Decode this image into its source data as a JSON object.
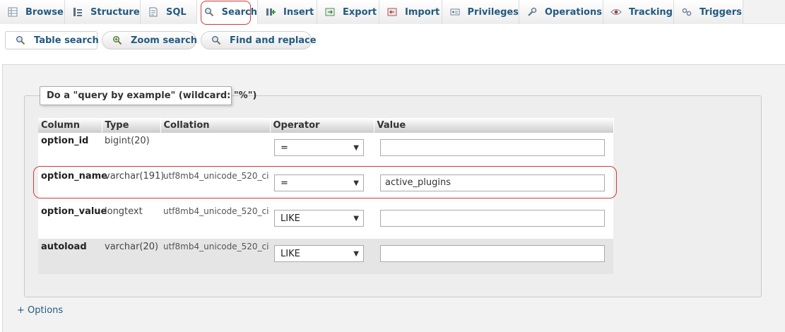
{
  "tabs": [
    {
      "label": "Browse",
      "icon": "browse-icon"
    },
    {
      "label": "Structure",
      "icon": "structure-icon"
    },
    {
      "label": "SQL",
      "icon": "sql-icon"
    },
    {
      "label": "Search",
      "icon": "search-icon",
      "active": true
    },
    {
      "label": "Insert",
      "icon": "insert-icon"
    },
    {
      "label": "Export",
      "icon": "export-icon"
    },
    {
      "label": "Import",
      "icon": "import-icon"
    },
    {
      "label": "Privileges",
      "icon": "privileges-icon"
    },
    {
      "label": "Operations",
      "icon": "wrench-icon"
    },
    {
      "label": "Tracking",
      "icon": "eye-icon"
    },
    {
      "label": "Triggers",
      "icon": "triggers-icon"
    }
  ],
  "subtabs": [
    {
      "label": "Table search",
      "icon": "magnifier-icon",
      "active": true
    },
    {
      "label": "Zoom search",
      "icon": "zoom-icon"
    },
    {
      "label": "Find and replace",
      "icon": "magnifier-icon"
    }
  ],
  "legend": "Do a \"query by example\" (wildcard: \"%\")",
  "table": {
    "headers": [
      "Column",
      "Type",
      "Collation",
      "Operator",
      "Value"
    ],
    "rows": [
      {
        "column": "option_id",
        "type": "bigint(20)",
        "collation": "",
        "operator": "=",
        "value": ""
      },
      {
        "column": "option_name",
        "type": "varchar(191)",
        "collation": "utf8mb4_unicode_520_ci",
        "operator": "=",
        "value": "active_plugins"
      },
      {
        "column": "option_value",
        "type": "longtext",
        "collation": "utf8mb4_unicode_520_ci",
        "operator": "LIKE",
        "value": ""
      },
      {
        "column": "autoload",
        "type": "varchar(20)",
        "collation": "utf8mb4_unicode_520_ci",
        "operator": "LIKE",
        "value": ""
      }
    ]
  },
  "options_link": "+ Options",
  "colors": {
    "link": "#235a81",
    "highlight": "#d03a3a",
    "panel": "#eeeeee"
  }
}
